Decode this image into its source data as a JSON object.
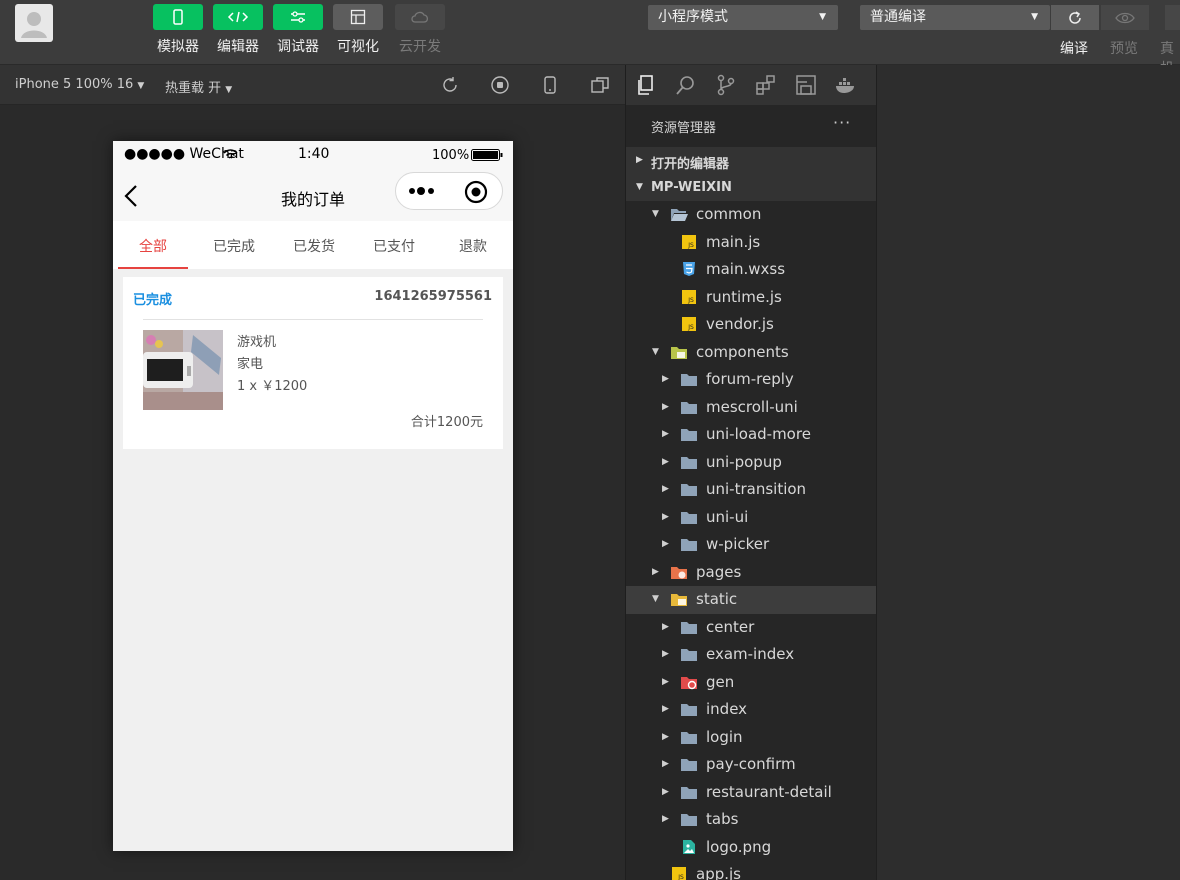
{
  "toolbar": {
    "buttons": [
      {
        "label": "模拟器",
        "icon": "phone-icon"
      },
      {
        "label": "编辑器",
        "icon": "code-icon"
      },
      {
        "label": "调试器",
        "icon": "debug-icon"
      },
      {
        "label": "可视化",
        "icon": "layout-icon"
      },
      {
        "label": "云开发",
        "icon": "cloud-icon"
      }
    ],
    "mode_select": "小程序模式",
    "compile_select": "普通编译",
    "right_labels": {
      "compile": "编译",
      "preview": "预览",
      "real_device": "真机"
    }
  },
  "simulator": {
    "device": "iPhone 5 100% 16",
    "hot_reload": "热重载 开"
  },
  "phone": {
    "status": {
      "carrier": "●●●●● WeChat",
      "time": "1:40",
      "battery": "100%"
    },
    "nav_title": "我的订单",
    "tabs": [
      "全部",
      "已完成",
      "已发货",
      "已支付",
      "退款"
    ],
    "order": {
      "status": "已完成",
      "number": "1641265975561",
      "item_name": "游戏机",
      "category": "家电",
      "qty_price": "1 x ￥1200",
      "total": "合计1200元"
    }
  },
  "explorer": {
    "title": "资源管理器",
    "more": "···",
    "sections": {
      "open_editors": "打开的编辑器",
      "project": "MP-WEIXIN"
    },
    "rows": [
      {
        "name": "common",
        "kind": "folder-open",
        "level": 1,
        "arrow": "▼"
      },
      {
        "name": "main.js",
        "kind": "js",
        "level": 2,
        "arrow": ""
      },
      {
        "name": "main.wxss",
        "kind": "css",
        "level": 2,
        "arrow": ""
      },
      {
        "name": "runtime.js",
        "kind": "js",
        "level": 2,
        "arrow": ""
      },
      {
        "name": "vendor.js",
        "kind": "js",
        "level": 2,
        "arrow": ""
      },
      {
        "name": "components",
        "kind": "folder-comp",
        "level": 1,
        "arrow": "▼"
      },
      {
        "name": "forum-reply",
        "kind": "folder",
        "level": 2,
        "arrow": "▶"
      },
      {
        "name": "mescroll-uni",
        "kind": "folder",
        "level": 2,
        "arrow": "▶"
      },
      {
        "name": "uni-load-more",
        "kind": "folder",
        "level": 2,
        "arrow": "▶"
      },
      {
        "name": "uni-popup",
        "kind": "folder",
        "level": 2,
        "arrow": "▶"
      },
      {
        "name": "uni-transition",
        "kind": "folder",
        "level": 2,
        "arrow": "▶"
      },
      {
        "name": "uni-ui",
        "kind": "folder",
        "level": 2,
        "arrow": "▶"
      },
      {
        "name": "w-picker",
        "kind": "folder",
        "level": 2,
        "arrow": "▶"
      },
      {
        "name": "pages",
        "kind": "folder-pages",
        "level": 1,
        "arrow": "▶"
      },
      {
        "name": "static",
        "kind": "folder-static",
        "level": 1,
        "arrow": "▼",
        "selected": true
      },
      {
        "name": "center",
        "kind": "folder",
        "level": 2,
        "arrow": "▶"
      },
      {
        "name": "exam-index",
        "kind": "folder",
        "level": 2,
        "arrow": "▶"
      },
      {
        "name": "gen",
        "kind": "folder-gen",
        "level": 2,
        "arrow": "▶"
      },
      {
        "name": "index",
        "kind": "folder",
        "level": 2,
        "arrow": "▶"
      },
      {
        "name": "login",
        "kind": "folder",
        "level": 2,
        "arrow": "▶"
      },
      {
        "name": "pay-confirm",
        "kind": "folder",
        "level": 2,
        "arrow": "▶"
      },
      {
        "name": "restaurant-detail",
        "kind": "folder",
        "level": 2,
        "arrow": "▶"
      },
      {
        "name": "tabs",
        "kind": "folder",
        "level": 2,
        "arrow": "▶"
      },
      {
        "name": "logo.png",
        "kind": "image",
        "level": 2,
        "arrow": ""
      },
      {
        "name": "app.js",
        "kind": "js",
        "level": 1,
        "arrow": ""
      }
    ]
  },
  "colors": {
    "accent_green": "#07c160",
    "tab_active": "#e64340",
    "status_blue": "#1a8fe0"
  }
}
